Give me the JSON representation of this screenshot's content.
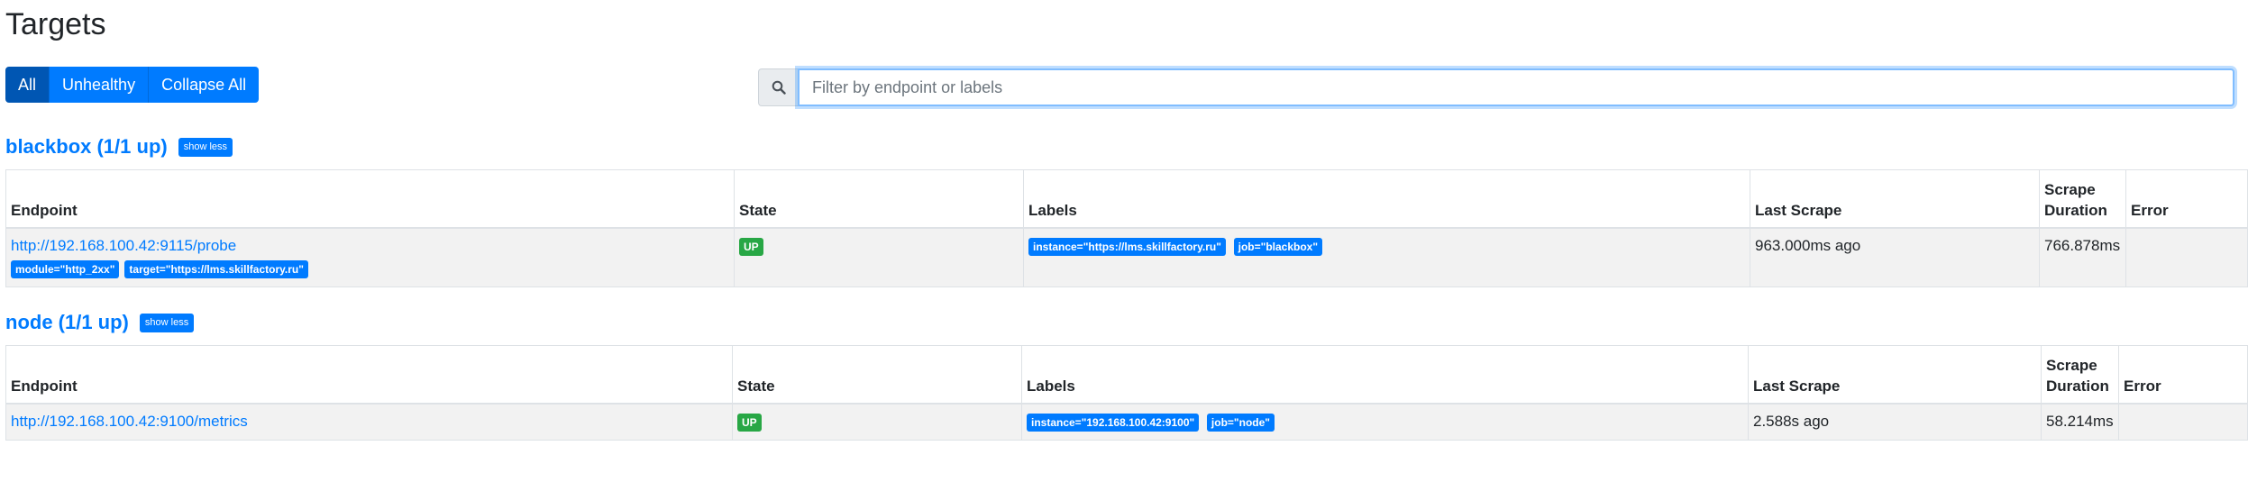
{
  "page": {
    "title": "Targets"
  },
  "filters": {
    "all_label": "All",
    "unhealthy_label": "Unhealthy",
    "collapse_label": "Collapse All"
  },
  "search": {
    "placeholder": "Filter by endpoint or labels",
    "value": ""
  },
  "columns": {
    "endpoint": "Endpoint",
    "state": "State",
    "labels": "Labels",
    "last_scrape": "Last Scrape",
    "scrape_duration": "Scrape Duration",
    "error": "Error"
  },
  "pools": [
    {
      "title": "blackbox (1/1 up)",
      "toggle_label": "show less",
      "targets": [
        {
          "endpoint": "http://192.168.100.42:9115/probe",
          "endpoint_labels": [
            "module=\"http_2xx\"",
            "target=\"https://lms.skillfactory.ru\""
          ],
          "state": "UP",
          "labels": [
            "instance=\"https://lms.skillfactory.ru\"",
            "job=\"blackbox\""
          ],
          "last_scrape": "963.000ms ago",
          "scrape_duration": "766.878ms",
          "error": ""
        }
      ]
    },
    {
      "title": "node (1/1 up)",
      "toggle_label": "show less",
      "targets": [
        {
          "endpoint": "http://192.168.100.42:9100/metrics",
          "endpoint_labels": [],
          "state": "UP",
          "labels": [
            "instance=\"192.168.100.42:9100\"",
            "job=\"node\""
          ],
          "last_scrape": "2.588s ago",
          "scrape_duration": "58.214ms",
          "error": ""
        }
      ]
    }
  ],
  "colors": {
    "primary": "#007bff",
    "success": "#28a745",
    "focus_border": "#80bdff"
  },
  "icons": {
    "search": "search-icon"
  }
}
